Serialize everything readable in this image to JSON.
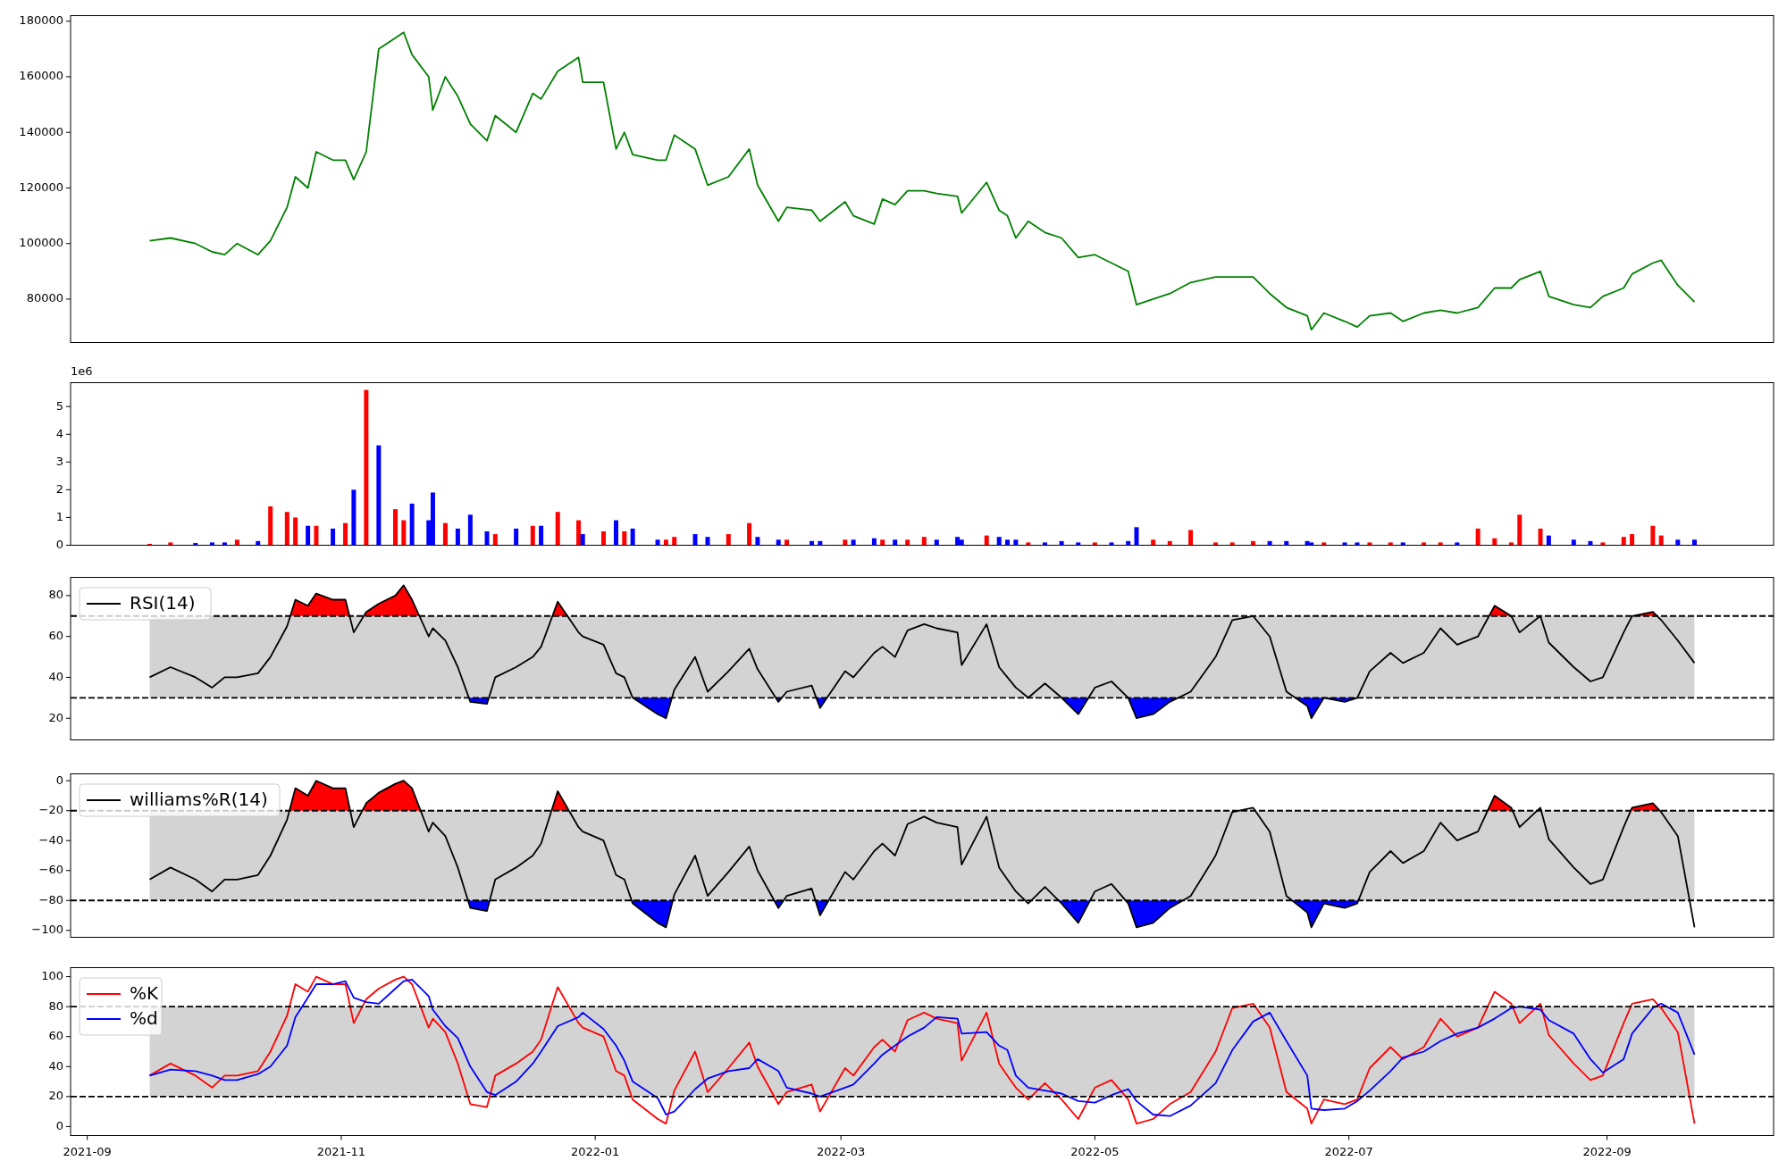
{
  "figure": {
    "panels": [
      {
        "chart_data": {
          "type": "line",
          "x": [
            "2021-09-16",
            "2021-09-21",
            "2021-09-27",
            "2021-10-01",
            "2021-10-04",
            "2021-10-07",
            "2021-10-12",
            "2021-10-15",
            "2021-10-19",
            "2021-10-21",
            "2021-10-24",
            "2021-10-26",
            "2021-10-30",
            "2021-11-02",
            "2021-11-04",
            "2021-11-07",
            "2021-11-10",
            "2021-11-14",
            "2021-11-16",
            "2021-11-18",
            "2021-11-22",
            "2021-11-23",
            "2021-11-26",
            "2021-11-29",
            "2021-12-02",
            "2021-12-06",
            "2021-12-08",
            "2021-12-13",
            "2021-12-17",
            "2021-12-19",
            "2021-12-23",
            "2021-12-28",
            "2021-12-29",
            "2022-01-03",
            "2022-01-06",
            "2022-01-08",
            "2022-01-10",
            "2022-01-16",
            "2022-01-18",
            "2022-01-20",
            "2022-01-25",
            "2022-01-28",
            "2022-02-02",
            "2022-02-07",
            "2022-02-09",
            "2022-02-14",
            "2022-02-16",
            "2022-02-22",
            "2022-02-24",
            "2022-03-02",
            "2022-03-04",
            "2022-03-09",
            "2022-03-11",
            "2022-03-14",
            "2022-03-17",
            "2022-03-21",
            "2022-03-24",
            "2022-03-29",
            "2022-03-30",
            "2022-04-05",
            "2022-04-08",
            "2022-04-10",
            "2022-04-12",
            "2022-04-15",
            "2022-04-19",
            "2022-04-23",
            "2022-04-27",
            "2022-05-01",
            "2022-05-05",
            "2022-05-09",
            "2022-05-11",
            "2022-05-15",
            "2022-05-19",
            "2022-05-24",
            "2022-05-30",
            "2022-06-03",
            "2022-06-08",
            "2022-06-12",
            "2022-06-16",
            "2022-06-21",
            "2022-06-22",
            "2022-06-25",
            "2022-06-30",
            "2022-07-03",
            "2022-07-06",
            "2022-07-11",
            "2022-07-14",
            "2022-07-19",
            "2022-07-23",
            "2022-07-27",
            "2022-08-01",
            "2022-08-05",
            "2022-08-09",
            "2022-08-11",
            "2022-08-16",
            "2022-08-18",
            "2022-08-24",
            "2022-08-28",
            "2022-08-31",
            "2022-09-05",
            "2022-09-07",
            "2022-09-12",
            "2022-09-14",
            "2022-09-18",
            "2022-09-22"
          ],
          "series": [
            {
              "color": "#008000",
              "values": [
                101000,
                102000,
                100000,
                97000,
                96000,
                100000,
                96000,
                101000,
                113000,
                124000,
                120000,
                133000,
                130000,
                130000,
                123000,
                133000,
                170000,
                174000,
                176000,
                168000,
                160000,
                148000,
                160000,
                153000,
                143000,
                137000,
                146000,
                140000,
                154000,
                152000,
                162000,
                167000,
                158000,
                158000,
                134000,
                140000,
                132000,
                130000,
                130000,
                139000,
                134000,
                121000,
                124000,
                134000,
                121000,
                108000,
                113000,
                112000,
                108000,
                115000,
                110000,
                107000,
                116000,
                114000,
                119000,
                119000,
                118000,
                117000,
                111000,
                122000,
                112000,
                110000,
                102000,
                108000,
                104000,
                102000,
                95000,
                96000,
                93000,
                90000,
                78000,
                80000,
                82000,
                86000,
                88000,
                88000,
                88000,
                82000,
                77000,
                74000,
                69000,
                75000,
                72000,
                70000,
                74000,
                75000,
                72000,
                75000,
                76000,
                75000,
                77000,
                84000,
                84000,
                87000,
                90000,
                81000,
                78000,
                77000,
                81000,
                84000,
                89000,
                93000,
                94000,
                85000,
                79000
              ]
            }
          ],
          "xlim": [
            "2021-08-28",
            "2022-10-11"
          ],
          "ylim": [
            64400,
            182000
          ],
          "yticks": [
            80000,
            100000,
            120000,
            140000,
            160000,
            180000
          ]
        }
      },
      {
        "offset_text": "1e6",
        "chart_data": {
          "type": "bar",
          "x": [
            "2021-09-16",
            "2021-09-21",
            "2021-09-27",
            "2021-10-01",
            "2021-10-04",
            "2021-10-07",
            "2021-10-12",
            "2021-10-15",
            "2021-10-19",
            "2021-10-21",
            "2021-10-24",
            "2021-10-26",
            "2021-10-30",
            "2021-11-02",
            "2021-11-04",
            "2021-11-07",
            "2021-11-10",
            "2021-11-14",
            "2021-11-16",
            "2021-11-18",
            "2021-11-22",
            "2021-11-23",
            "2021-11-26",
            "2021-11-29",
            "2021-12-02",
            "2021-12-06",
            "2021-12-08",
            "2021-12-13",
            "2021-12-17",
            "2021-12-19",
            "2021-12-23",
            "2021-12-28",
            "2021-12-29",
            "2022-01-03",
            "2022-01-06",
            "2022-01-08",
            "2022-01-10",
            "2022-01-16",
            "2022-01-18",
            "2022-01-20",
            "2022-01-25",
            "2022-01-28",
            "2022-02-02",
            "2022-02-07",
            "2022-02-09",
            "2022-02-14",
            "2022-02-16",
            "2022-02-22",
            "2022-02-24",
            "2022-03-02",
            "2022-03-04",
            "2022-03-09",
            "2022-03-11",
            "2022-03-14",
            "2022-03-17",
            "2022-03-21",
            "2022-03-24",
            "2022-03-29",
            "2022-03-30",
            "2022-04-05",
            "2022-04-08",
            "2022-04-10",
            "2022-04-12",
            "2022-04-15",
            "2022-04-19",
            "2022-04-23",
            "2022-04-27",
            "2022-05-01",
            "2022-05-05",
            "2022-05-09",
            "2022-05-11",
            "2022-05-15",
            "2022-05-19",
            "2022-05-24",
            "2022-05-30",
            "2022-06-03",
            "2022-06-08",
            "2022-06-12",
            "2022-06-16",
            "2022-06-21",
            "2022-06-22",
            "2022-06-25",
            "2022-06-30",
            "2022-07-03",
            "2022-07-06",
            "2022-07-11",
            "2022-07-14",
            "2022-07-19",
            "2022-07-23",
            "2022-07-27",
            "2022-08-01",
            "2022-08-05",
            "2022-08-09",
            "2022-08-11",
            "2022-08-16",
            "2022-08-18",
            "2022-08-24",
            "2022-08-28",
            "2022-08-31",
            "2022-09-05",
            "2022-09-07",
            "2022-09-12",
            "2022-09-14",
            "2022-09-18",
            "2022-09-22"
          ],
          "series": [
            {
              "color": "#ff0000",
              "values": [
                0.05,
                0.1,
                null,
                null,
                null,
                0.2,
                null,
                1.4,
                1.2,
                1.0,
                null,
                0.7,
                null,
                0.8,
                null,
                5.6,
                null,
                1.3,
                0.9,
                null,
                null,
                null,
                0.8,
                null,
                null,
                null,
                0.4,
                null,
                0.7,
                null,
                1.2,
                0.9,
                null,
                0.5,
                null,
                0.5,
                null,
                null,
                0.2,
                0.3,
                null,
                null,
                0.4,
                0.8,
                null,
                null,
                0.2,
                null,
                null,
                0.2,
                null,
                null,
                0.2,
                null,
                0.2,
                0.3,
                null,
                null,
                null,
                0.35,
                null,
                null,
                null,
                0.1,
                null,
                null,
                null,
                0.1,
                null,
                null,
                null,
                0.2,
                0.15,
                0.55,
                0.1,
                0.1,
                0.15,
                null,
                null,
                null,
                null,
                0.1,
                null,
                null,
                0.1,
                0.1,
                null,
                0.1,
                0.1,
                null,
                0.6,
                0.25,
                0.1,
                1.1,
                0.6,
                null,
                null,
                null,
                0.1,
                0.3,
                0.4,
                0.7,
                0.35,
                null,
                null
              ]
            },
            {
              "color": "#0000ff",
              "values": [
                null,
                null,
                0.08,
                0.1,
                0.1,
                null,
                0.15,
                null,
                null,
                null,
                0.7,
                null,
                0.6,
                null,
                2.0,
                null,
                3.6,
                null,
                null,
                1.5,
                0.9,
                1.9,
                null,
                0.6,
                1.1,
                0.5,
                null,
                0.6,
                null,
                0.7,
                null,
                null,
                0.4,
                null,
                0.9,
                null,
                0.6,
                0.2,
                null,
                null,
                0.4,
                0.3,
                null,
                null,
                0.3,
                0.2,
                null,
                0.15,
                0.15,
                null,
                0.2,
                0.25,
                null,
                0.2,
                null,
                null,
                0.2,
                0.3,
                0.2,
                null,
                0.3,
                0.2,
                0.2,
                null,
                0.1,
                0.15,
                0.1,
                null,
                0.1,
                0.15,
                0.65,
                null,
                null,
                null,
                null,
                null,
                null,
                0.15,
                0.15,
                0.15,
                0.1,
                null,
                0.1,
                0.1,
                null,
                null,
                0.1,
                null,
                null,
                0.1,
                null,
                null,
                null,
                null,
                null,
                0.35,
                0.2,
                0.15,
                null,
                null,
                null,
                null,
                null,
                0.2,
                0.2
              ]
            }
          ],
          "xlim": [
            "2021-08-28",
            "2022-10-11"
          ],
          "ylim": [
            0,
            5.86
          ],
          "yticks": [
            0,
            1,
            2,
            3,
            4,
            5
          ]
        }
      },
      {
        "chart_data": {
          "type": "line",
          "x": [
            "2021-09-16",
            "2021-09-21",
            "2021-09-27",
            "2021-10-01",
            "2021-10-04",
            "2021-10-07",
            "2021-10-12",
            "2021-10-15",
            "2021-10-19",
            "2021-10-21",
            "2021-10-24",
            "2021-10-26",
            "2021-10-30",
            "2021-11-02",
            "2021-11-04",
            "2021-11-07",
            "2021-11-10",
            "2021-11-14",
            "2021-11-16",
            "2021-11-18",
            "2021-11-22",
            "2021-11-23",
            "2021-11-26",
            "2021-11-29",
            "2021-12-02",
            "2021-12-06",
            "2021-12-08",
            "2021-12-13",
            "2021-12-17",
            "2021-12-19",
            "2021-12-23",
            "2021-12-28",
            "2021-12-29",
            "2022-01-03",
            "2022-01-06",
            "2022-01-08",
            "2022-01-10",
            "2022-01-16",
            "2022-01-18",
            "2022-01-20",
            "2022-01-25",
            "2022-01-28",
            "2022-02-02",
            "2022-02-07",
            "2022-02-09",
            "2022-02-14",
            "2022-02-16",
            "2022-02-22",
            "2022-02-24",
            "2022-03-02",
            "2022-03-04",
            "2022-03-09",
            "2022-03-11",
            "2022-03-14",
            "2022-03-17",
            "2022-03-21",
            "2022-03-24",
            "2022-03-29",
            "2022-03-30",
            "2022-04-05",
            "2022-04-08",
            "2022-04-10",
            "2022-04-12",
            "2022-04-15",
            "2022-04-19",
            "2022-04-23",
            "2022-04-27",
            "2022-05-01",
            "2022-05-05",
            "2022-05-09",
            "2022-05-11",
            "2022-05-15",
            "2022-05-19",
            "2022-05-24",
            "2022-05-30",
            "2022-06-03",
            "2022-06-08",
            "2022-06-12",
            "2022-06-16",
            "2022-06-21",
            "2022-06-22",
            "2022-06-25",
            "2022-06-30",
            "2022-07-03",
            "2022-07-06",
            "2022-07-11",
            "2022-07-14",
            "2022-07-19",
            "2022-07-23",
            "2022-07-27",
            "2022-08-01",
            "2022-08-05",
            "2022-08-09",
            "2022-08-11",
            "2022-08-16",
            "2022-08-18",
            "2022-08-24",
            "2022-08-28",
            "2022-08-31",
            "2022-09-05",
            "2022-09-07",
            "2022-09-12",
            "2022-09-14",
            "2022-09-18",
            "2022-09-22"
          ],
          "series": [
            {
              "name": "RSI(14)",
              "color": "#000000",
              "values": [
                40,
                45,
                40,
                35,
                40,
                40,
                42,
                50,
                65,
                78,
                75,
                81,
                78,
                78,
                62,
                72,
                76,
                80,
                85,
                78,
                60,
                64,
                58,
                45,
                28,
                27,
                40,
                45,
                50,
                55,
                77,
                62,
                60,
                56,
                42,
                40,
                30,
                22,
                20,
                34,
                50,
                33,
                43,
                54,
                44,
                28,
                33,
                36,
                25,
                43,
                40,
                52,
                55,
                50,
                63,
                66,
                64,
                62,
                46,
                66,
                45,
                40,
                35,
                30,
                37,
                30,
                22,
                35,
                38,
                30,
                20,
                22,
                28,
                33,
                50,
                68,
                70,
                60,
                33,
                26,
                20,
                30,
                28,
                30,
                43,
                52,
                47,
                52,
                64,
                56,
                60,
                75,
                70,
                62,
                70,
                57,
                45,
                38,
                40,
                62,
                70,
                72,
                68,
                58,
                47
              ]
            }
          ],
          "xlim": [
            "2021-08-28",
            "2022-10-11"
          ],
          "ylim": [
            9.4,
            88.9
          ],
          "yticks": [
            20,
            40,
            60,
            80
          ],
          "legend": "upper left",
          "bands": [
            {
              "axis": "y",
              "from": 30,
              "to": 70,
              "color": "#d3d3d3"
            }
          ],
          "ref_lines": [
            {
              "axis": "y",
              "value": 70
            },
            {
              "axis": "y",
              "value": 30
            }
          ]
        }
      },
      {
        "chart_data": {
          "type": "line",
          "x": [
            "2021-09-16",
            "2021-09-21",
            "2021-09-27",
            "2021-10-01",
            "2021-10-04",
            "2021-10-07",
            "2021-10-12",
            "2021-10-15",
            "2021-10-19",
            "2021-10-21",
            "2021-10-24",
            "2021-10-26",
            "2021-10-30",
            "2021-11-02",
            "2021-11-04",
            "2021-11-07",
            "2021-11-10",
            "2021-11-14",
            "2021-11-16",
            "2021-11-18",
            "2021-11-22",
            "2021-11-23",
            "2021-11-26",
            "2021-11-29",
            "2021-12-02",
            "2021-12-06",
            "2021-12-08",
            "2021-12-13",
            "2021-12-17",
            "2021-12-19",
            "2021-12-23",
            "2021-12-28",
            "2021-12-29",
            "2022-01-03",
            "2022-01-06",
            "2022-01-08",
            "2022-01-10",
            "2022-01-16",
            "2022-01-18",
            "2022-01-20",
            "2022-01-25",
            "2022-01-28",
            "2022-02-02",
            "2022-02-07",
            "2022-02-09",
            "2022-02-14",
            "2022-02-16",
            "2022-02-22",
            "2022-02-24",
            "2022-03-02",
            "2022-03-04",
            "2022-03-09",
            "2022-03-11",
            "2022-03-14",
            "2022-03-17",
            "2022-03-21",
            "2022-03-24",
            "2022-03-29",
            "2022-03-30",
            "2022-04-05",
            "2022-04-08",
            "2022-04-10",
            "2022-04-12",
            "2022-04-15",
            "2022-04-19",
            "2022-04-23",
            "2022-04-27",
            "2022-05-01",
            "2022-05-05",
            "2022-05-09",
            "2022-05-11",
            "2022-05-15",
            "2022-05-19",
            "2022-05-24",
            "2022-05-30",
            "2022-06-03",
            "2022-06-08",
            "2022-06-12",
            "2022-06-16",
            "2022-06-21",
            "2022-06-22",
            "2022-06-25",
            "2022-06-30",
            "2022-07-03",
            "2022-07-06",
            "2022-07-11",
            "2022-07-14",
            "2022-07-19",
            "2022-07-23",
            "2022-07-27",
            "2022-08-01",
            "2022-08-05",
            "2022-08-09",
            "2022-08-11",
            "2022-08-16",
            "2022-08-18",
            "2022-08-24",
            "2022-08-28",
            "2022-08-31",
            "2022-09-05",
            "2022-09-07",
            "2022-09-12",
            "2022-09-14",
            "2022-09-18",
            "2022-09-22"
          ],
          "series": [
            {
              "name": "williams%R(14)",
              "color": "#000000",
              "values": [
                -66,
                -58,
                -66,
                -74,
                -66,
                -66,
                -63,
                -50,
                -26,
                -5,
                -10,
                0,
                -5,
                -5,
                -31,
                -15,
                -8,
                -2,
                0,
                -5,
                -34,
                -28,
                -37,
                -58,
                -85,
                -87,
                -66,
                -58,
                -50,
                -42,
                -7,
                -31,
                -34,
                -40,
                -63,
                -66,
                -82,
                -95,
                -98,
                -76,
                -50,
                -77,
                -61,
                -44,
                -60,
                -85,
                -77,
                -72,
                -90,
                -61,
                -66,
                -47,
                -42,
                -50,
                -29,
                -24,
                -28,
                -31,
                -56,
                -24,
                -58,
                -66,
                -74,
                -82,
                -71,
                -82,
                -95,
                -74,
                -69,
                -82,
                -98,
                -95,
                -85,
                -77,
                -50,
                -21,
                -18,
                -34,
                -77,
                -88,
                -98,
                -82,
                -85,
                -82,
                -61,
                -47,
                -55,
                -47,
                -28,
                -40,
                -34,
                -10,
                -18,
                -31,
                -18,
                -39,
                -58,
                -69,
                -66,
                -31,
                -18,
                -15,
                -21,
                -37,
                -98
              ]
            }
          ],
          "xlim": [
            "2021-08-28",
            "2022-10-11"
          ],
          "ylim": [
            -104.6,
            4.6
          ],
          "yticks": [
            {
              "value": -100,
              "label": "−100"
            },
            {
              "value": -80,
              "label": "−80"
            },
            {
              "value": -60,
              "label": "−60"
            },
            {
              "value": -40,
              "label": "−40"
            },
            {
              "value": -20,
              "label": "−20"
            },
            {
              "value": 0,
              "label": "0"
            }
          ],
          "legend": "upper left",
          "bands": [
            {
              "axis": "y",
              "from": -80,
              "to": -20,
              "color": "#d3d3d3"
            }
          ],
          "ref_lines": [
            {
              "axis": "y",
              "value": -20
            },
            {
              "axis": "y",
              "value": -80
            }
          ]
        }
      },
      {
        "chart_data": {
          "type": "line",
          "x": [
            "2021-09-16",
            "2021-09-21",
            "2021-09-27",
            "2021-10-01",
            "2021-10-04",
            "2021-10-07",
            "2021-10-12",
            "2021-10-15",
            "2021-10-19",
            "2021-10-21",
            "2021-10-24",
            "2021-10-26",
            "2021-10-30",
            "2021-11-02",
            "2021-11-04",
            "2021-11-07",
            "2021-11-10",
            "2021-11-14",
            "2021-11-16",
            "2021-11-18",
            "2021-11-22",
            "2021-11-23",
            "2021-11-26",
            "2021-11-29",
            "2021-12-02",
            "2021-12-06",
            "2021-12-08",
            "2021-12-13",
            "2021-12-17",
            "2021-12-19",
            "2021-12-23",
            "2021-12-28",
            "2021-12-29",
            "2022-01-03",
            "2022-01-06",
            "2022-01-08",
            "2022-01-10",
            "2022-01-16",
            "2022-01-18",
            "2022-01-20",
            "2022-01-25",
            "2022-01-28",
            "2022-02-02",
            "2022-02-07",
            "2022-02-09",
            "2022-02-14",
            "2022-02-16",
            "2022-02-22",
            "2022-02-24",
            "2022-03-02",
            "2022-03-04",
            "2022-03-09",
            "2022-03-11",
            "2022-03-14",
            "2022-03-17",
            "2022-03-21",
            "2022-03-24",
            "2022-03-29",
            "2022-03-30",
            "2022-04-05",
            "2022-04-08",
            "2022-04-10",
            "2022-04-12",
            "2022-04-15",
            "2022-04-19",
            "2022-04-23",
            "2022-04-27",
            "2022-05-01",
            "2022-05-05",
            "2022-05-09",
            "2022-05-11",
            "2022-05-15",
            "2022-05-19",
            "2022-05-24",
            "2022-05-30",
            "2022-06-03",
            "2022-06-08",
            "2022-06-12",
            "2022-06-16",
            "2022-06-21",
            "2022-06-22",
            "2022-06-25",
            "2022-06-30",
            "2022-07-03",
            "2022-07-06",
            "2022-07-11",
            "2022-07-14",
            "2022-07-19",
            "2022-07-23",
            "2022-07-27",
            "2022-08-01",
            "2022-08-05",
            "2022-08-09",
            "2022-08-11",
            "2022-08-16",
            "2022-08-18",
            "2022-08-24",
            "2022-08-28",
            "2022-08-31",
            "2022-09-05",
            "2022-09-07",
            "2022-09-12",
            "2022-09-14",
            "2022-09-18",
            "2022-09-22"
          ],
          "series": [
            {
              "name": "%K",
              "color": "#ff0000",
              "values": [
                34,
                42,
                34,
                26,
                34,
                34,
                37,
                50,
                74,
                95,
                90,
                100,
                95,
                95,
                69,
                85,
                92,
                98,
                100,
                95,
                66,
                72,
                63,
                42,
                15,
                13,
                34,
                42,
                50,
                58,
                93,
                69,
                66,
                60,
                37,
                34,
                18,
                5,
                2,
                24,
                50,
                23,
                39,
                56,
                40,
                15,
                23,
                28,
                10,
                39,
                34,
                53,
                58,
                50,
                71,
                76,
                72,
                69,
                44,
                76,
                42,
                34,
                26,
                18,
                29,
                18,
                5,
                26,
                31,
                18,
                2,
                5,
                15,
                23,
                50,
                79,
                82,
                66,
                23,
                12,
                2,
                18,
                15,
                18,
                39,
                53,
                45,
                53,
                72,
                60,
                66,
                90,
                82,
                69,
                82,
                61,
                42,
                31,
                34,
                69,
                82,
                85,
                79,
                63,
                2
              ]
            },
            {
              "name": "%d",
              "color": "#0000ff",
              "values": [
                34,
                38,
                37,
                34,
                31,
                31,
                35,
                40,
                54,
                73,
                86,
                95,
                95,
                97,
                86,
                83,
                82,
                92,
                97,
                98,
                87,
                78,
                67,
                59,
                40,
                23,
                21,
                30,
                42,
                50,
                67,
                73,
                76,
                65,
                54,
                44,
                30,
                19,
                8,
                10,
                25,
                32,
                37,
                39,
                45,
                37,
                26,
                22,
                20,
                26,
                28,
                42,
                48,
                54,
                60,
                66,
                73,
                72,
                62,
                63,
                54,
                51,
                34,
                26,
                24,
                22,
                17,
                16,
                21,
                25,
                17,
                8,
                7,
                14,
                29,
                51,
                70,
                76,
                57,
                34,
                12,
                11,
                12,
                17,
                24,
                37,
                46,
                50,
                57,
                62,
                66,
                72,
                79,
                80,
                78,
                71,
                62,
                45,
                36,
                45,
                62,
                79,
                82,
                76,
                48
              ]
            }
          ],
          "xlim": [
            "2021-08-28",
            "2022-10-11"
          ],
          "ylim": [
            -6,
            106
          ],
          "yticks": [
            0,
            20,
            40,
            60,
            80,
            100
          ],
          "xticks": [
            {
              "value": "2021-09-01",
              "label": "2021-09"
            },
            {
              "value": "2021-11-01",
              "label": "2021-11"
            },
            {
              "value": "2022-01-01",
              "label": "2022-01"
            },
            {
              "value": "2022-03-01",
              "label": "2022-03"
            },
            {
              "value": "2022-05-01",
              "label": "2022-05"
            },
            {
              "value": "2022-07-01",
              "label": "2022-07"
            },
            {
              "value": "2022-09-01",
              "label": "2022-09"
            }
          ],
          "legend": "upper left",
          "bands": [
            {
              "axis": "y",
              "from": 20,
              "to": 80,
              "color": "#d3d3d3"
            }
          ],
          "ref_lines": [
            {
              "axis": "y",
              "value": 80
            },
            {
              "axis": "y",
              "value": 20
            }
          ]
        }
      }
    ]
  }
}
